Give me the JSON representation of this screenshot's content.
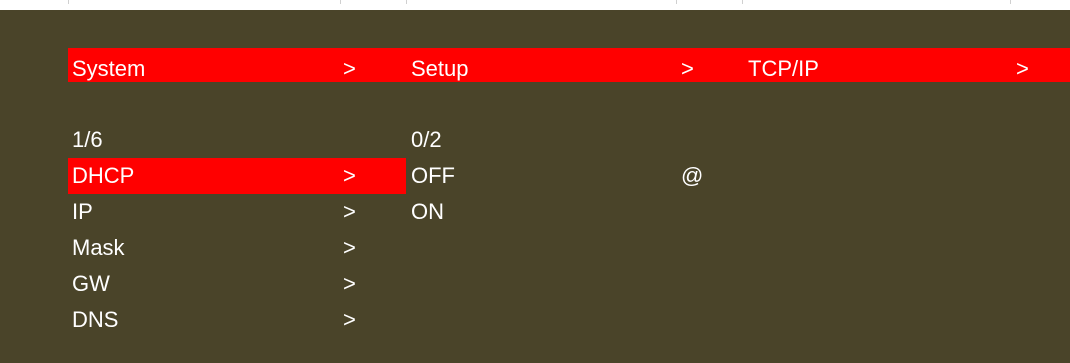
{
  "colors": {
    "background": "#4a4429",
    "highlight": "#ff0000",
    "text": "#ffffff"
  },
  "header": {
    "items": [
      {
        "label": "System",
        "arrow": ">"
      },
      {
        "label": "Setup",
        "arrow": ">"
      },
      {
        "label": "TCP/IP",
        "arrow": ">"
      }
    ]
  },
  "menu": {
    "page": "1/6",
    "items": [
      {
        "label": "DHCP",
        "arrow": ">"
      },
      {
        "label": "IP",
        "arrow": ">"
      },
      {
        "label": "Mask",
        "arrow": ">"
      },
      {
        "label": "GW",
        "arrow": ">"
      },
      {
        "label": "DNS",
        "arrow": ">"
      }
    ]
  },
  "submenu": {
    "page": "0/2",
    "options": [
      "OFF",
      "ON"
    ],
    "current_marker": "@"
  }
}
